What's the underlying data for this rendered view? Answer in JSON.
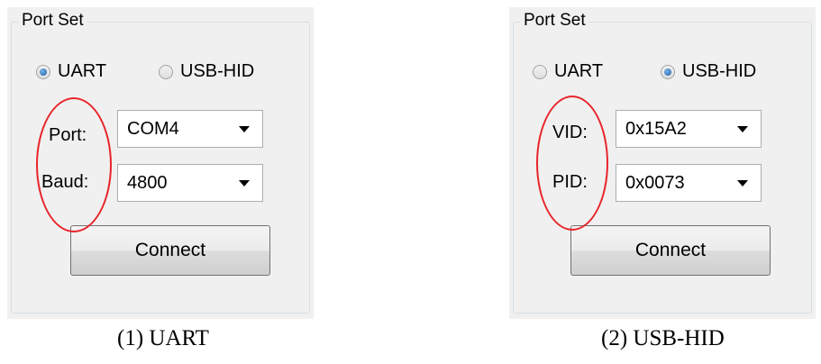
{
  "figures": [
    {
      "group_title": "Port Set",
      "radio_uart": "UART",
      "radio_hid": "USB-HID",
      "selected": "UART",
      "field1_label": "Port:",
      "field1_value": "COM4",
      "field2_label": "Baud:",
      "field2_value": "4800",
      "button_label": "Connect",
      "caption": "(1) UART"
    },
    {
      "group_title": "Port Set",
      "radio_uart": "UART",
      "radio_hid": "USB-HID",
      "selected": "USB-HID",
      "field1_label": "VID:",
      "field1_value": "0x15A2",
      "field2_label": "PID:",
      "field2_value": "0x0073",
      "button_label": "Connect",
      "caption": "(2) USB-HID"
    }
  ],
  "colors": {
    "highlight_ellipse": "#e8242a",
    "radio_selected": "#1f5fa8",
    "panel_background": "#f0f0f0"
  }
}
